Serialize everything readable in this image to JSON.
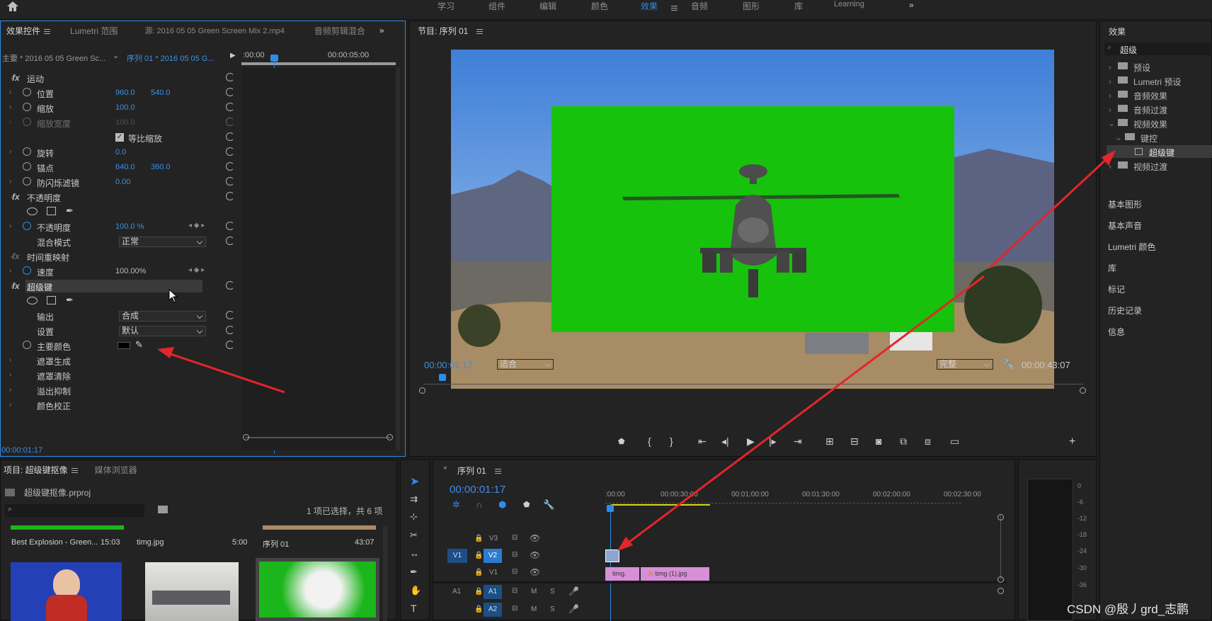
{
  "topbar": {
    "nav": [
      "学习",
      "组件",
      "编辑",
      "颜色",
      "效果",
      "音频",
      "图形",
      "库",
      "Learning"
    ],
    "active": "效果"
  },
  "effect_controls": {
    "tabs": [
      "效果控件",
      "Lumetri 范围",
      "源: 2016 05 05 Green Screen Mix 2.mp4",
      "音频剪辑混合"
    ],
    "master_clip": "主要 * 2016 05 05 Green Sc...",
    "sequence_clip": "序列 01 * 2016 05 05 G...",
    "ruler_start": ":00:00",
    "ruler_end": "00:00:05:00",
    "rows": {
      "motion": "运动",
      "position": "位置",
      "position_x": "960.0",
      "position_y": "540.0",
      "scale": "缩放",
      "scale_value": "100.0",
      "scale_width": "缩放宽度",
      "scale_width_value": "100.0",
      "uniform_scale": "等比缩放",
      "rotation": "旋转",
      "rotation_value": "0.0",
      "anchor": "锚点",
      "anchor_x": "640.0",
      "anchor_y": "360.0",
      "flicker": "防闪烁滤镜",
      "flicker_value": "0.00",
      "opacity_section": "不透明度",
      "opacity": "不透明度",
      "opacity_value": "100.0 %",
      "blend_mode": "混合模式",
      "blend_value": "正常",
      "time_remap": "时间重映射",
      "speed": "速度",
      "speed_value": "100.00%",
      "ultra_key": "超级键",
      "output": "输出",
      "output_value": "合成",
      "setting": "设置",
      "setting_value": "默认",
      "key_color": "主要颜色",
      "matte_gen": "遮罩生成",
      "matte_cleanup": "遮罩清除",
      "spill": "溢出抑制",
      "color_correct": "颜色校正"
    },
    "timecode": "00:00:01:17"
  },
  "program": {
    "title": "节目: 序列 01",
    "timecode": "00:00:01:17",
    "fit": "适合",
    "quality": "完整",
    "duration": "00:00:43:07"
  },
  "effects_panel": {
    "title": "效果",
    "search": "超级",
    "tree": [
      "预设",
      "Lumetri 预设",
      "音频效果",
      "音频过渡",
      "视频效果",
      "键控",
      "超级键",
      "视频过渡"
    ],
    "sections": [
      "基本图形",
      "基本声音",
      "Lumetri 颜色",
      "库",
      "标记",
      "历史记录",
      "信息"
    ]
  },
  "project": {
    "tabs": [
      "项目: 超级键抠像",
      "媒体浏览器"
    ],
    "file": "超级键抠像.prproj",
    "count": "1 项已选择，共 6 项",
    "items": [
      {
        "name": "Best Explosion - Green...",
        "dur": "15:03"
      },
      {
        "name": "timg.jpg",
        "dur": "5:00"
      },
      {
        "name": "序列 01",
        "dur": "43:07"
      }
    ]
  },
  "timeline": {
    "title": "序列 01",
    "timecode": "00:00:01:17",
    "ruler": [
      ":00:00",
      "00:00:30:00",
      "00:01:00:00",
      "00:01:30:00",
      "00:02:00:00",
      "00:02:30:00"
    ],
    "tracks": [
      "V3",
      "V2",
      "V1",
      "A1",
      "A2"
    ],
    "clips": [
      "timg.",
      "timg (1).jpg"
    ]
  },
  "meter": [
    "0",
    "-6",
    "-12",
    "-18",
    "-24",
    "-30",
    "-36"
  ],
  "watermark": "CSDN @殷丿grd_志鹏",
  "colors": {
    "accent": "#2d8ceb",
    "arrow": "#e3262a",
    "green_screen": "#16c20b",
    "clip_pink": "#d78fd8"
  }
}
